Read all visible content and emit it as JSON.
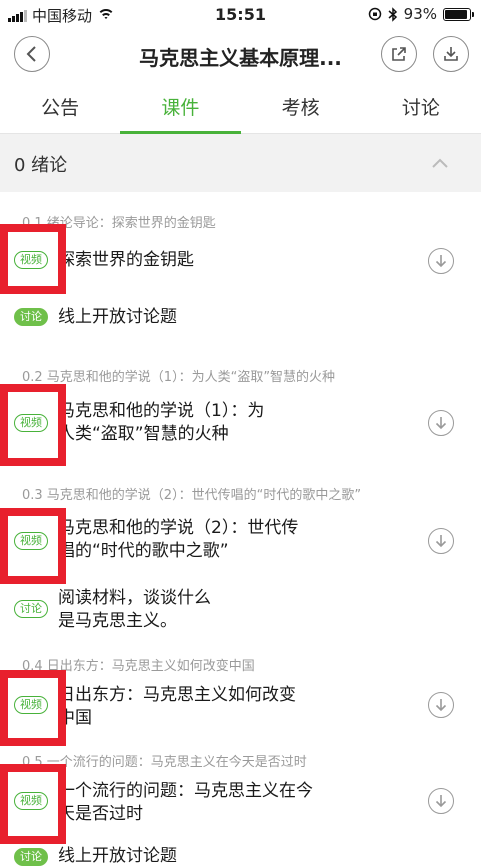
{
  "status_bar": {
    "carrier": "中国移动",
    "time": "15:51",
    "battery": "93%",
    "battery_level": 0.93
  },
  "nav": {
    "title": "马克思主义基本原理..."
  },
  "tabs": [
    {
      "label": "公告"
    },
    {
      "label": "课件"
    },
    {
      "label": "考核"
    },
    {
      "label": "讨论"
    }
  ],
  "chapter": {
    "title": "0 绪论"
  },
  "sections": [
    {
      "label": "0.1 绪论导论：探索世界的金钥匙"
    },
    {
      "label": "0.2 马克思和他的学说（1）：为人类“盗取”智慧的火种"
    },
    {
      "label": "0.3 马克思和他的学说（2）：世代传唱的“时代的歌中之歌”"
    },
    {
      "label": "0.4 日出东方：马克思主义如何改变中国"
    },
    {
      "label": "0.5 一个流行的问题：马克思主义在今天是否过时"
    }
  ],
  "items": [
    {
      "badge": "视频",
      "line1": "探索世界的金钥匙",
      "line2": ""
    },
    {
      "badge": "讨论",
      "line1": "线上开放讨论题",
      "line2": ""
    },
    {
      "badge": "视频",
      "line1": "马克思和他的学说（1）：为",
      "line2": "人类“盗取”智慧的火种"
    },
    {
      "badge": "视频",
      "line1": "马克思和他的学说（2）：世代传",
      "line2": "唱的“时代的歌中之歌”"
    },
    {
      "badge": "讨论",
      "line1": "阅读材料，谈谈什么",
      "line2": "是马克思主义。"
    },
    {
      "badge": "视频",
      "line1": "日出东方：马克思主义如何改变",
      "line2": "中国"
    },
    {
      "badge": "视频",
      "line1": "一个流行的问题：马克思主义在今",
      "line2": "天是否过时"
    },
    {
      "badge": "讨论",
      "line1": "线上开放讨论题",
      "line2": ""
    }
  ],
  "colors": {
    "accent": "#48b23a",
    "highlight": "#e8202d"
  }
}
